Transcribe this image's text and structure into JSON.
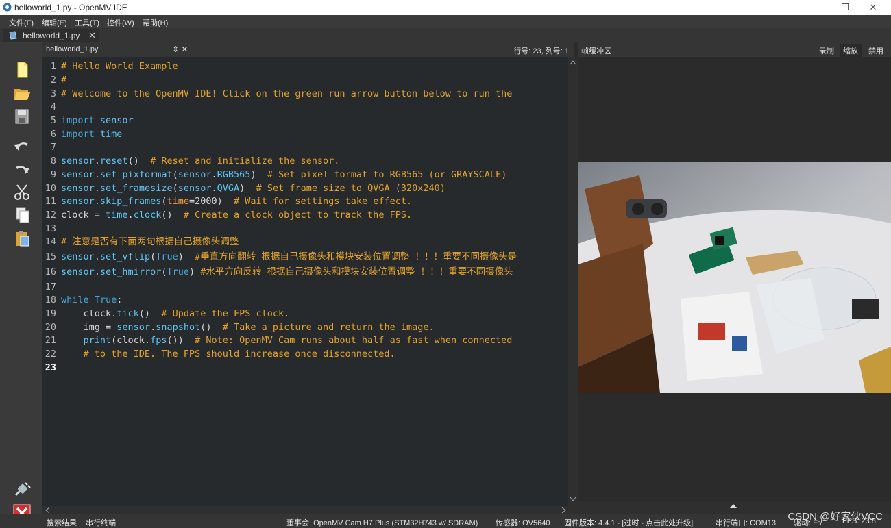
{
  "window": {
    "title": "helloworld_1.py - OpenMV IDE",
    "minimize": "—",
    "restore": "❐",
    "close": "✕"
  },
  "menu": {
    "file": "文件(F)",
    "edit": "编辑(E)",
    "tools": "工具(T)",
    "controls": "控件(W)",
    "help": "帮助(H)"
  },
  "tab": {
    "label": "helloworld_1.py",
    "close": "✕"
  },
  "editor": {
    "filename": "helloworld_1.py",
    "controls": "⇕ ✕",
    "position": "行号: 23, 列号: 1",
    "lines": [
      {
        "n": "1",
        "parts": [
          {
            "t": "# Hello World Example",
            "c": "comment"
          }
        ]
      },
      {
        "n": "2",
        "parts": [
          {
            "t": "#",
            "c": "comment"
          }
        ]
      },
      {
        "n": "3",
        "parts": [
          {
            "t": "# Welcome to the OpenMV IDE! Click on the green run arrow button below to run the",
            "c": "comment"
          }
        ]
      },
      {
        "n": "4",
        "parts": []
      },
      {
        "n": "5",
        "parts": [
          {
            "t": "import",
            "c": "kw"
          },
          {
            "t": " sensor",
            "c": "fn"
          }
        ]
      },
      {
        "n": "6",
        "parts": [
          {
            "t": "import",
            "c": "kw"
          },
          {
            "t": " time",
            "c": "fn"
          }
        ]
      },
      {
        "n": "7",
        "parts": []
      },
      {
        "n": "8",
        "parts": [
          {
            "t": "sensor",
            "c": "fn"
          },
          {
            "t": ".",
            "c": "plain"
          },
          {
            "t": "reset",
            "c": "fn"
          },
          {
            "t": "()  ",
            "c": "plain"
          },
          {
            "t": "# Reset and initialize the sensor.",
            "c": "comment"
          }
        ]
      },
      {
        "n": "9",
        "parts": [
          {
            "t": "sensor",
            "c": "fn"
          },
          {
            "t": ".",
            "c": "plain"
          },
          {
            "t": "set_pixformat",
            "c": "fn"
          },
          {
            "t": "(",
            "c": "plain"
          },
          {
            "t": "sensor",
            "c": "fn"
          },
          {
            "t": ".",
            "c": "plain"
          },
          {
            "t": "RGB565",
            "c": "fn"
          },
          {
            "t": ")  ",
            "c": "plain"
          },
          {
            "t": "# Set pixel format to RGB565 (or GRAYSCALE)",
            "c": "comment"
          }
        ]
      },
      {
        "n": "10",
        "parts": [
          {
            "t": "sensor",
            "c": "fn"
          },
          {
            "t": ".",
            "c": "plain"
          },
          {
            "t": "set_framesize",
            "c": "fn"
          },
          {
            "t": "(",
            "c": "plain"
          },
          {
            "t": "sensor",
            "c": "fn"
          },
          {
            "t": ".",
            "c": "plain"
          },
          {
            "t": "QVGA",
            "c": "fn"
          },
          {
            "t": ")  ",
            "c": "plain"
          },
          {
            "t": "# Set frame size to QVGA (320x240)",
            "c": "comment"
          }
        ]
      },
      {
        "n": "11",
        "parts": [
          {
            "t": "sensor",
            "c": "fn"
          },
          {
            "t": ".",
            "c": "plain"
          },
          {
            "t": "skip_frames",
            "c": "fn"
          },
          {
            "t": "(",
            "c": "plain"
          },
          {
            "t": "time",
            "c": "arg"
          },
          {
            "t": "=2000)  ",
            "c": "plain"
          },
          {
            "t": "# Wait for settings take effect.",
            "c": "comment"
          }
        ]
      },
      {
        "n": "12",
        "parts": [
          {
            "t": "clock = ",
            "c": "plain"
          },
          {
            "t": "time",
            "c": "fn"
          },
          {
            "t": ".",
            "c": "plain"
          },
          {
            "t": "clock",
            "c": "fn"
          },
          {
            "t": "()  ",
            "c": "plain"
          },
          {
            "t": "# Create a clock object to track the FPS.",
            "c": "comment"
          }
        ]
      },
      {
        "n": "13",
        "parts": []
      },
      {
        "n": "14",
        "parts": [
          {
            "t": "# 注意是否有下面两句根据自己摄像头调整",
            "c": "comment"
          }
        ]
      },
      {
        "n": "15",
        "parts": [
          {
            "t": "sensor",
            "c": "fn"
          },
          {
            "t": ".",
            "c": "plain"
          },
          {
            "t": "set_vflip",
            "c": "fn"
          },
          {
            "t": "(",
            "c": "plain"
          },
          {
            "t": "True",
            "c": "kw"
          },
          {
            "t": ")  ",
            "c": "plain"
          },
          {
            "t": "#垂直方向翻转 根据自己摄像头和模块安装位置调整 ！！！重要不同摄像头是",
            "c": "comment"
          }
        ]
      },
      {
        "n": "16",
        "parts": [
          {
            "t": "sensor",
            "c": "fn"
          },
          {
            "t": ".",
            "c": "plain"
          },
          {
            "t": "set_hmirror",
            "c": "fn"
          },
          {
            "t": "(",
            "c": "plain"
          },
          {
            "t": "True",
            "c": "kw"
          },
          {
            "t": ") ",
            "c": "plain"
          },
          {
            "t": "#水平方向反转 根据自己摄像头和模块安装位置调整 ！！！重要不同摄像头",
            "c": "comment"
          }
        ]
      },
      {
        "n": "17",
        "parts": []
      },
      {
        "n": "18",
        "parts": [
          {
            "t": "while",
            "c": "kw"
          },
          {
            "t": " True",
            "c": "kw"
          },
          {
            "t": ":",
            "c": "plain"
          }
        ]
      },
      {
        "n": "19",
        "parts": [
          {
            "t": "    clock.",
            "c": "plain"
          },
          {
            "t": "tick",
            "c": "fn"
          },
          {
            "t": "()  ",
            "c": "plain"
          },
          {
            "t": "# Update the FPS clock.",
            "c": "comment"
          }
        ]
      },
      {
        "n": "20",
        "parts": [
          {
            "t": "    img = ",
            "c": "plain"
          },
          {
            "t": "sensor",
            "c": "fn"
          },
          {
            "t": ".",
            "c": "plain"
          },
          {
            "t": "snapshot",
            "c": "fn"
          },
          {
            "t": "()  ",
            "c": "plain"
          },
          {
            "t": "# Take a picture and return the image.",
            "c": "comment"
          }
        ]
      },
      {
        "n": "21",
        "parts": [
          {
            "t": "    ",
            "c": "plain"
          },
          {
            "t": "print",
            "c": "fn"
          },
          {
            "t": "(clock.",
            "c": "plain"
          },
          {
            "t": "fps",
            "c": "fn"
          },
          {
            "t": "())  ",
            "c": "plain"
          },
          {
            "t": "# Note: OpenMV Cam runs about half as fast when connected",
            "c": "comment"
          }
        ]
      },
      {
        "n": "22",
        "parts": [
          {
            "t": "    # to the IDE. The FPS should increase once disconnected.",
            "c": "comment"
          }
        ]
      },
      {
        "n": "23",
        "parts": []
      }
    ]
  },
  "framebuffer": {
    "title": "帧缓冲区",
    "record": "录制",
    "zoom": "缩放",
    "disable": "禁用"
  },
  "status": {
    "search_results": "搜索结果",
    "serial_terminal": "串行终端",
    "board": "董事会: OpenMV Cam H7 Plus (STM32H743 w/ SDRAM)",
    "sensor": "传感器: OV5640",
    "firmware": "固件版本: 4.4.1 - [过时 - 点击此处升级]",
    "port": "串行端口: COM13",
    "drive": "驱动: E:/",
    "fps": "FPS: 23.8"
  },
  "watermark": "CSDN @好家伙VCC",
  "colors": {
    "background": "#2b2b2b",
    "editor_bg": "#272a2d",
    "comment": "#e2a22b",
    "keyword": "#47a7d6",
    "identifier": "#5fc2f0"
  }
}
